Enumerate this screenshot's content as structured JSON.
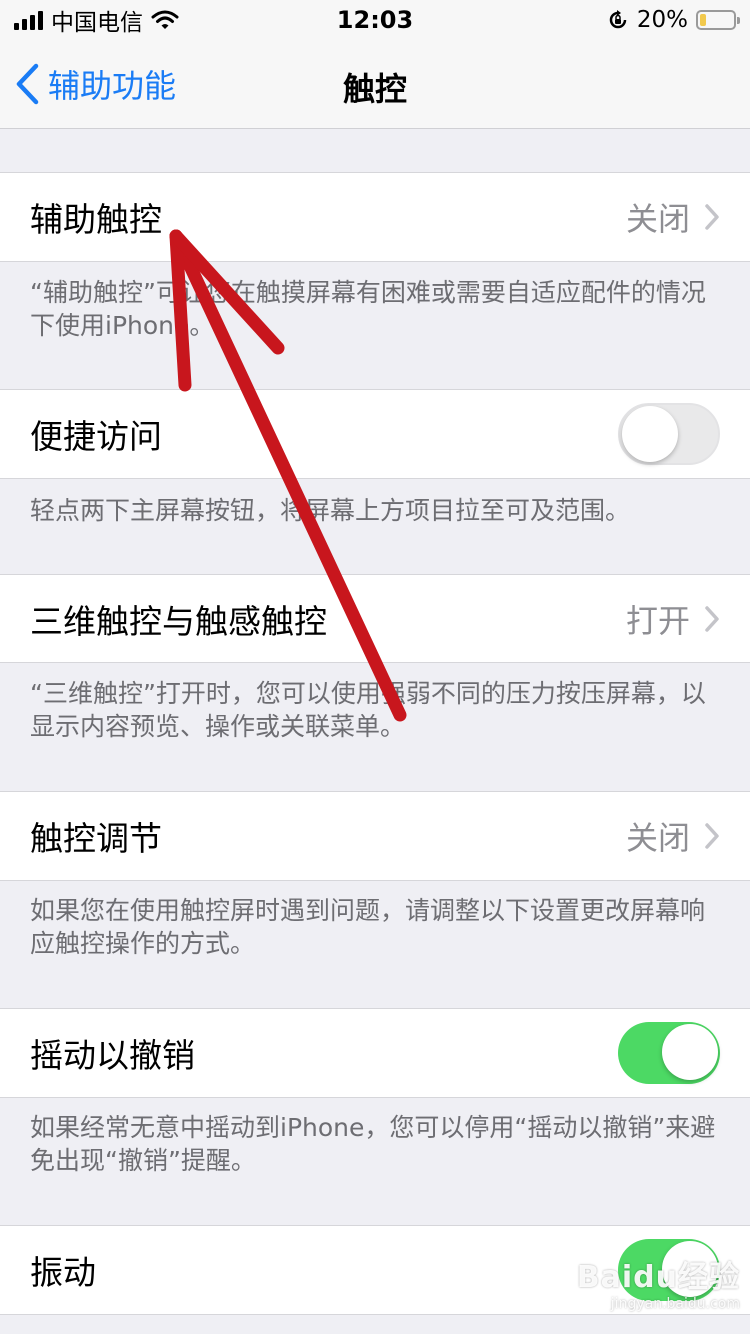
{
  "status_bar": {
    "carrier": "中国电信",
    "time": "12:03",
    "battery_percent": "20%",
    "battery_level": 0.2
  },
  "nav": {
    "back_label": "辅助功能",
    "title": "触控"
  },
  "rows": [
    {
      "label": "辅助触控",
      "value": "关闭",
      "footer": "“辅助触控”可让您在触摸屏幕有困难或需要自适应配件的情况下使用iPhone。"
    },
    {
      "label": "便捷访问",
      "toggle": false,
      "footer": "轻点两下主屏幕按钮，将屏幕上方项目拉至可及范围。"
    },
    {
      "label": "三维触控与触感触控",
      "value": "打开",
      "footer": "“三维触控”打开时，您可以使用强弱不同的压力按压屏幕，以显示内容预览、操作或关联菜单。"
    },
    {
      "label": "触控调节",
      "value": "关闭",
      "footer": "如果您在使用触控屏时遇到问题，请调整以下设置更改屏幕响应触控操作的方式。"
    },
    {
      "label": "摇动以撤销",
      "toggle": true,
      "footer": "如果经常无意中摇动到iPhone，您可以停用“摇动以撤销”来避免出现“撤销”提醒。"
    },
    {
      "label": "振动",
      "toggle": true
    }
  ],
  "watermark": {
    "brand": "Baidu经验",
    "site": "jingyan.baidu.com"
  },
  "colors": {
    "accent": "#1a7cf5",
    "toggle_on": "#4cd964",
    "annotation_arrow": "#c8161d"
  }
}
